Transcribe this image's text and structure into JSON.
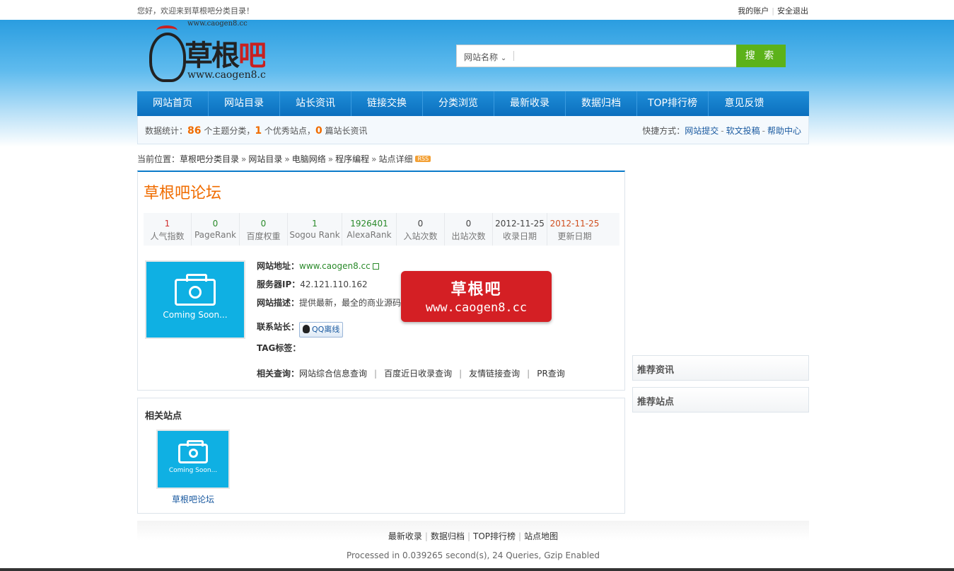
{
  "topbar": {
    "welcome": "您好，欢迎来到草根吧分类目录！",
    "my_account": "我的账户",
    "logout": "安全退出"
  },
  "logo": {
    "small_url": "www.caogen8.cc",
    "name_main": "草根",
    "name_accent": "吧",
    "url": "www.caogen8.cc"
  },
  "search": {
    "type_label": "网站名称",
    "placeholder": "",
    "button": "搜 索"
  },
  "nav": {
    "items": [
      "网站首页",
      "网站目录",
      "站长资讯",
      "链接交换",
      "分类浏览",
      "最新收录",
      "数据归档",
      "TOP排行榜",
      "意见反馈"
    ]
  },
  "stats": {
    "prefix": "数据统计：",
    "categories_count": "86",
    "categories_label": "个主题分类，",
    "sites_count": "1",
    "sites_label": "个优秀站点，",
    "articles_count": "0",
    "articles_label": "篇站长资讯",
    "shortcut_label": "快捷方式：",
    "shortcuts": [
      "网站提交",
      "软文投稿",
      "帮助中心"
    ]
  },
  "breadcrumb": {
    "prefix": "当前位置：",
    "items": [
      "草根吧分类目录",
      "网站目录",
      "电脑网络",
      "程序编程",
      "站点详细"
    ],
    "rss": "RSS"
  },
  "site": {
    "title": "草根吧论坛",
    "metrics": [
      {
        "value": "1",
        "label": "人气指数"
      },
      {
        "value": "0",
        "label": "PageRank"
      },
      {
        "value": "0",
        "label": "百度权重"
      },
      {
        "value": "1",
        "label": "Sogou Rank"
      },
      {
        "value": "1926401",
        "label": "AlexaRank"
      },
      {
        "value": "0",
        "label": "入站次数"
      },
      {
        "value": "0",
        "label": "出站次数"
      },
      {
        "value": "2012-11-25",
        "label": "收录日期"
      },
      {
        "value": "2012-11-25",
        "label": "更新日期"
      }
    ],
    "thumb_text": "Coming Soon...",
    "url_label": "网站地址：",
    "url": "www.caogen8.cc",
    "ip_label": "服务器IP：",
    "ip": "42.121.110.162",
    "desc_label": "网站描述：",
    "desc": "提供最新，最全的商业源码",
    "contact_label": "联系站长：",
    "qq_label": "QQ离线",
    "tag_label": "TAG标签：",
    "related_query_label": "相关查询：",
    "related_queries": [
      "网站综合信息查询",
      "百度近日收录查询",
      "友情链接查询",
      "PR查询"
    ]
  },
  "watermark": {
    "line1": "草根吧",
    "line2": "www.caogen8.cc"
  },
  "related": {
    "heading": "相关站点",
    "thumb_text": "Coming Soon...",
    "site_name": "草根吧论坛"
  },
  "sidebar": {
    "recommended_news": "推荐资讯",
    "recommended_sites": "推荐站点"
  },
  "footer": {
    "links": [
      "最新收录",
      "数据归档",
      "TOP排行榜",
      "站点地图"
    ],
    "processed": "Processed in 0.039265 second(s), 24 Queries, Gzip Enabled"
  }
}
